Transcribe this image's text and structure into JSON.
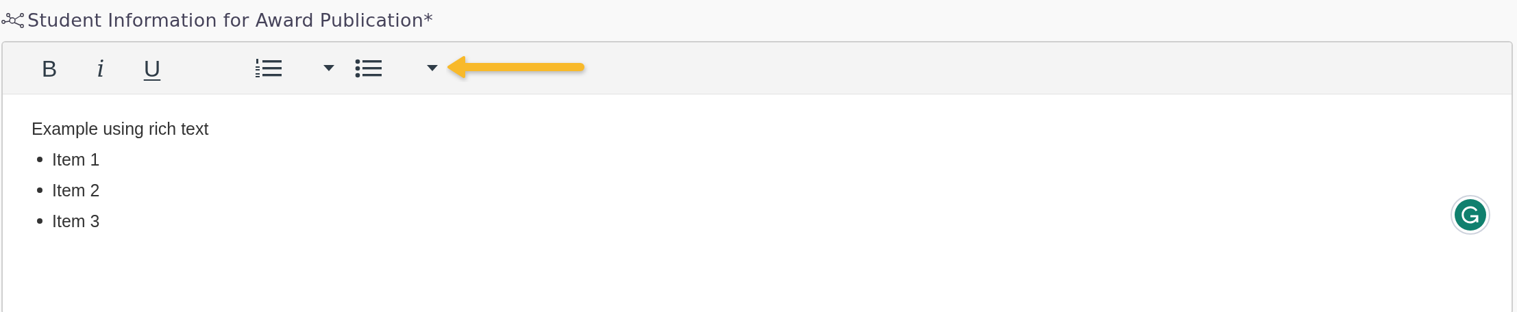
{
  "field": {
    "title": "Student Information for Award Publication*"
  },
  "toolbar": {
    "format_buttons": [
      {
        "kind": "bold",
        "label": "B"
      },
      {
        "kind": "italic",
        "label": "i"
      },
      {
        "kind": "underline",
        "label": "U"
      }
    ]
  },
  "content": {
    "paragraph": "Example using rich text",
    "bullets": [
      "Item 1",
      "Item 2",
      "Item 3"
    ]
  }
}
